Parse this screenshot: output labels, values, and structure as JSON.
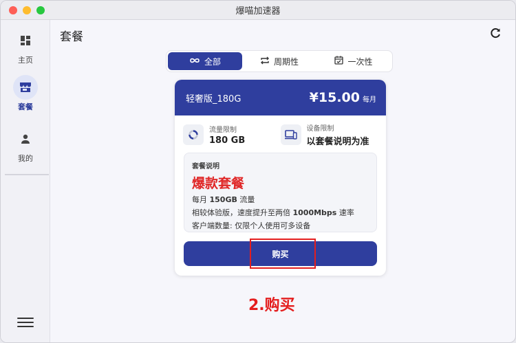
{
  "window": {
    "title": "爆喵加速器"
  },
  "sidebar": {
    "items": [
      {
        "label": "主页",
        "icon": "dashboard-icon"
      },
      {
        "label": "套餐",
        "icon": "store-icon",
        "active": true
      },
      {
        "label": "我的",
        "icon": "person-icon"
      }
    ],
    "menu_icon": "hamburger-icon"
  },
  "page": {
    "title": "套餐",
    "refresh_icon": "refresh-icon"
  },
  "filter": {
    "items": [
      {
        "label": "全部",
        "icon": "infinity-icon",
        "active": true
      },
      {
        "label": "周期性",
        "icon": "repeat-icon"
      },
      {
        "label": "一次性",
        "icon": "calendar-check-icon"
      }
    ]
  },
  "plan": {
    "name": "轻奢版_180G",
    "price": "¥15.00",
    "period": "每月",
    "traffic_label": "流量限制",
    "traffic_value": "180 GB",
    "device_label": "设备限制",
    "device_value": "以套餐说明为准",
    "desc_title": "套餐说明",
    "desc_headline": "爆款套餐",
    "desc_line1_prefix": "每月 ",
    "desc_line1_bold": "150GB",
    "desc_line1_suffix": " 流量",
    "desc_line2_prefix": "相较体验版，速度提升至两倍 ",
    "desc_line2_bold": "1000Mbps",
    "desc_line2_suffix": " 速率",
    "desc_line3": "客户端数量: 仅限个人使用可多设备",
    "buy_label": "购买"
  },
  "annotation": {
    "step_label": "2.购买"
  },
  "colors": {
    "primary": "#2f3e9e",
    "highlight": "#e41e1e"
  }
}
